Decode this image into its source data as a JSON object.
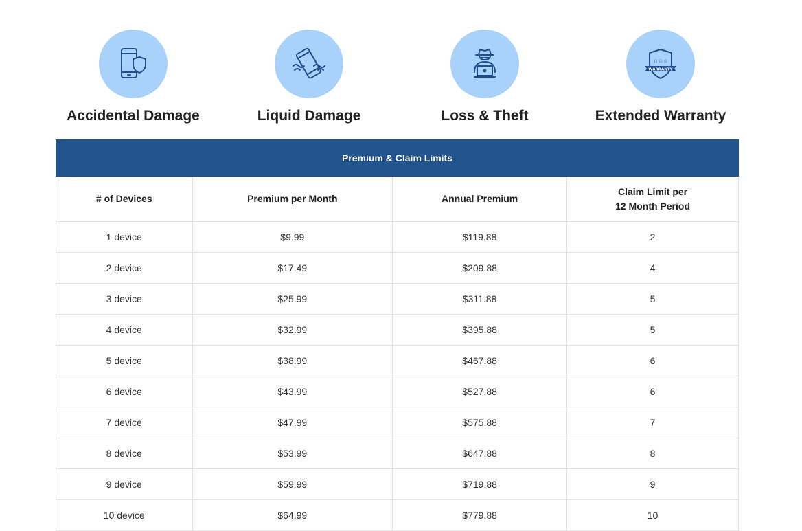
{
  "features": [
    {
      "icon": "phone-shield-icon",
      "title": "Accidental Damage"
    },
    {
      "icon": "phone-water-icon",
      "title": "Liquid Damage"
    },
    {
      "icon": "hacker-laptop-icon",
      "title": "Loss & Theft"
    },
    {
      "icon": "warranty-badge-icon",
      "title": "Extended Warranty",
      "badge_text": "WARRANTY"
    }
  ],
  "table": {
    "caption": "Premium & Claim Limits",
    "headers": [
      "# of Devices",
      "Premium per Month",
      "Annual Premium",
      "Claim Limit per",
      "12 Month Period"
    ],
    "rows": [
      [
        "1 device",
        "$9.99",
        "$119.88",
        "2"
      ],
      [
        "2 device",
        "$17.49",
        "$209.88",
        "4"
      ],
      [
        "3 device",
        "$25.99",
        "$311.88",
        "5"
      ],
      [
        "4 device",
        "$32.99",
        "$395.88",
        "5"
      ],
      [
        "5 device",
        "$38.99",
        "$467.88",
        "6"
      ],
      [
        "6 device",
        "$43.99",
        "$527.88",
        "6"
      ],
      [
        "7 device",
        "$47.99",
        "$575.88",
        "7"
      ],
      [
        "8 device",
        "$53.99",
        "$647.88",
        "8"
      ],
      [
        "9 device",
        "$59.99",
        "$719.88",
        "9"
      ],
      [
        "10 device",
        "$64.99",
        "$779.88",
        "10"
      ]
    ]
  },
  "colors": {
    "icon_circle": "#a9d2fb",
    "icon_stroke": "#1f4e8c",
    "table_header_bg": "#21548f",
    "table_border": "#e2e2e2"
  }
}
